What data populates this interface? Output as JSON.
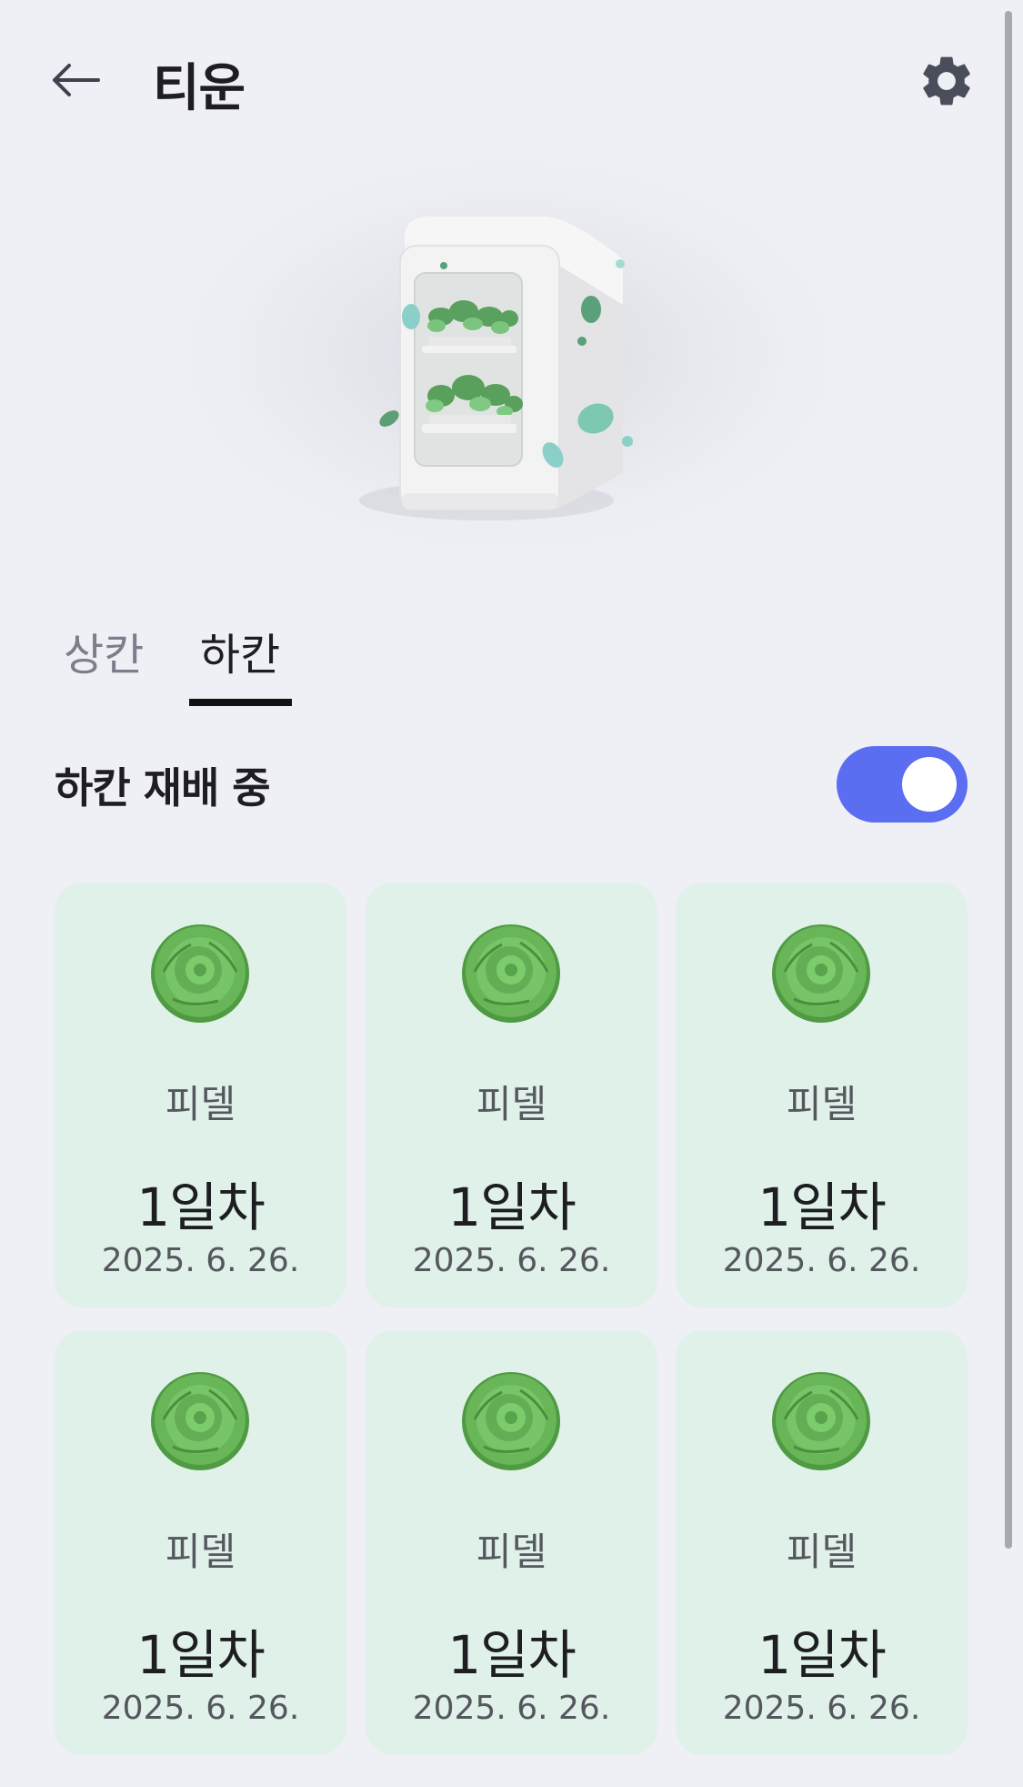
{
  "header": {
    "title": "티운",
    "back_icon": "arrow-left-icon",
    "settings_icon": "gear-icon"
  },
  "tabs": [
    {
      "label": "상칸",
      "selected": false
    },
    {
      "label": "하칸",
      "selected": true
    }
  ],
  "section": {
    "title": "하칸 재배 중",
    "toggle_on": true
  },
  "plants": [
    {
      "name": "피델",
      "day": "1일차",
      "date": "2025. 6. 26."
    },
    {
      "name": "피델",
      "day": "1일차",
      "date": "2025. 6. 26."
    },
    {
      "name": "피델",
      "day": "1일차",
      "date": "2025. 6. 26."
    },
    {
      "name": "피델",
      "day": "1일차",
      "date": "2025. 6. 26."
    },
    {
      "name": "피델",
      "day": "1일차",
      "date": "2025. 6. 26."
    },
    {
      "name": "피델",
      "day": "1일차",
      "date": "2025. 6. 26."
    }
  ],
  "colors": {
    "background": "#eff0f5",
    "card": "#dff1e8",
    "toggle_on": "#5b6df0"
  }
}
